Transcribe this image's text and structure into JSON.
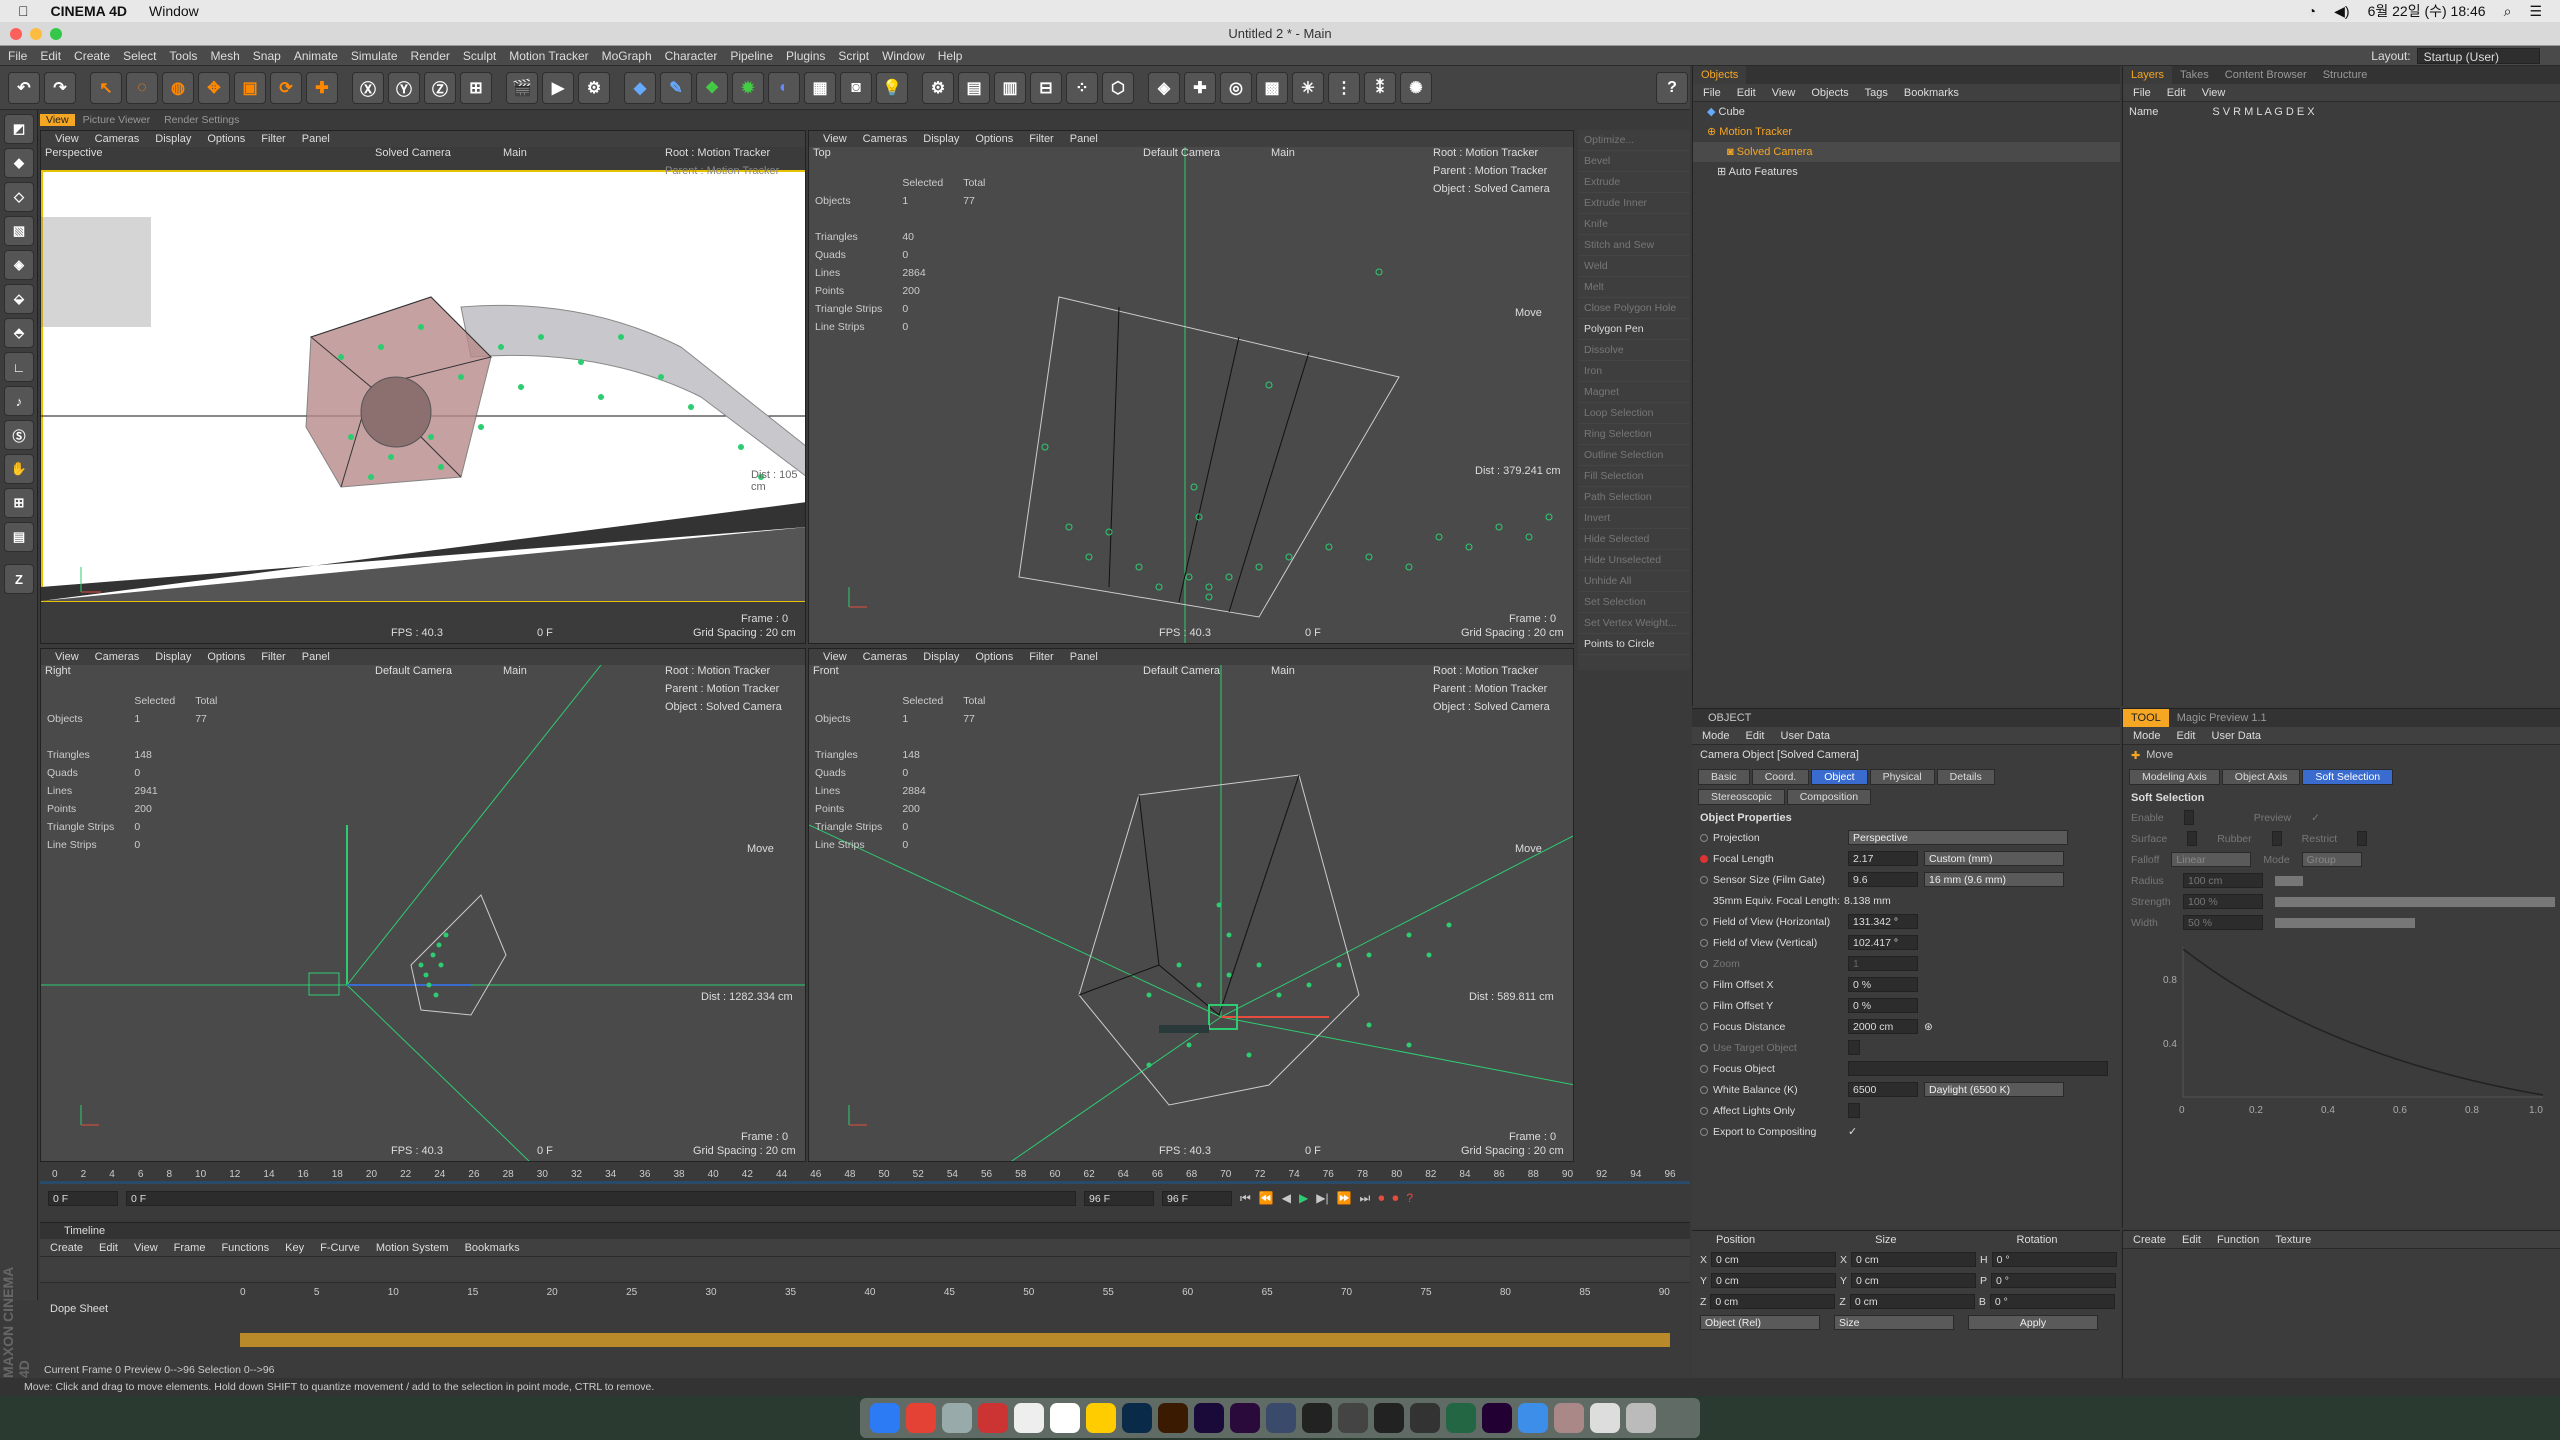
{
  "macbar": {
    "app": "CINEMA 4D",
    "menu": "Window",
    "clock": "6월 22일 (수) 18:46"
  },
  "window": {
    "title": "Untitled 2 * - Main"
  },
  "menu": [
    "File",
    "Edit",
    "Create",
    "Select",
    "Tools",
    "Mesh",
    "Snap",
    "Animate",
    "Simulate",
    "Render",
    "Sculpt",
    "Motion Tracker",
    "MoGraph",
    "Character",
    "Pipeline",
    "Plugins",
    "Script",
    "Window",
    "Help"
  ],
  "layout": {
    "label": "Layout:",
    "value": "Startup (User)"
  },
  "viewtabs": [
    "View",
    "Picture Viewer",
    "Render Settings"
  ],
  "vp_menu": [
    "View",
    "Cameras",
    "Display",
    "Options",
    "Filter",
    "Panel"
  ],
  "vp1": {
    "name": "Perspective",
    "camera": "Solved Camera",
    "main": "Main",
    "root": "Root : Motion Tracker",
    "parent": "Parent : Motion Tracker",
    "fps": "FPS : 40.3",
    "frame_f": "0 F",
    "frame": "Frame : 0",
    "grid": "Grid Spacing : 20 cm",
    "dist": "Dist : 105 cm"
  },
  "vp2": {
    "name": "Top",
    "camera": "Default Camera",
    "main": "Main",
    "root": "Root : Motion Tracker",
    "parent": "Parent : Motion Tracker",
    "object": "Object : Solved Camera",
    "move": "Move",
    "dist": "Dist : 379.241 cm",
    "fps": "FPS : 40.3",
    "frame_f": "0 F",
    "frame": "Frame : 0",
    "grid": "Grid Spacing : 20 cm",
    "stats": {
      "hdr_sel": "Selected",
      "hdr_tot": "Total",
      "objects": "Objects",
      "obj_sel": "1",
      "obj_tot": "77",
      "triangles": "Triangles",
      "tri": "40",
      "quads": "Quads",
      "qd": "0",
      "lines": "Lines",
      "ln": "2864",
      "points": "Points",
      "pt": "200",
      "tstrips": "Triangle Strips",
      "ts": "0",
      "lstrips": "Line Strips",
      "ls": "0"
    }
  },
  "vp3": {
    "name": "Right",
    "camera": "Default Camera",
    "main": "Main",
    "root": "Root : Motion Tracker",
    "parent": "Parent : Motion Tracker",
    "object": "Object : Solved Camera",
    "move": "Move",
    "dist": "Dist : 1282.334 cm",
    "fps": "FPS : 40.3",
    "frame_f": "0 F",
    "frame": "Frame : 0",
    "grid": "Grid Spacing : 20 cm",
    "stats": {
      "hdr_sel": "Selected",
      "hdr_tot": "Total",
      "objects": "Objects",
      "obj_sel": "1",
      "obj_tot": "77",
      "triangles": "Triangles",
      "tri": "148",
      "quads": "Quads",
      "qd": "0",
      "lines": "Lines",
      "ln": "2941",
      "points": "Points",
      "pt": "200",
      "tstrips": "Triangle Strips",
      "ts": "0",
      "lstrips": "Line Strips",
      "ls": "0"
    }
  },
  "vp4": {
    "name": "Front",
    "camera": "Default Camera",
    "main": "Main",
    "root": "Root : Motion Tracker",
    "parent": "Parent : Motion Tracker",
    "object": "Object : Solved Camera",
    "move": "Move",
    "dist": "Dist : 589.811 cm",
    "fps": "FPS : 40.3",
    "frame_f": "0 F",
    "frame": "Frame : 0",
    "grid": "Grid Spacing : 20 cm",
    "stats": {
      "hdr_sel": "Selected",
      "hdr_tot": "Total",
      "objects": "Objects",
      "obj_sel": "1",
      "obj_tot": "77",
      "triangles": "Triangles",
      "tri": "148",
      "quads": "Quads",
      "qd": "0",
      "lines": "Lines",
      "ln": "2884",
      "points": "Points",
      "pt": "200",
      "tstrips": "Triangle Strips",
      "ts": "0",
      "lstrips": "Line Strips",
      "ls": "0"
    }
  },
  "commands": [
    "Optimize...",
    "Bevel",
    "Extrude",
    "Extrude Inner",
    "Knife",
    "Stitch and Sew",
    "Weld",
    "Melt",
    "Close Polygon Hole",
    "Polygon Pen",
    "Dissolve",
    "Iron",
    "Magnet",
    "Loop Selection",
    "Ring Selection",
    "Outline Selection",
    "Fill Selection",
    "Path Selection",
    "Invert",
    "Hide Selected",
    "Hide Unselected",
    "Unhide All",
    "Set Selection",
    "Set Vertex Weight...",
    "Points to Circle"
  ],
  "objects": {
    "tab": "Objects",
    "menu": [
      "File",
      "Edit",
      "View",
      "Objects",
      "Tags",
      "Bookmarks"
    ],
    "items": [
      "Cube",
      "Motion Tracker",
      "Solved Camera",
      "Auto Features"
    ]
  },
  "layers": {
    "tabs": [
      "Layers",
      "Takes",
      "Content Browser",
      "Structure"
    ],
    "menu": [
      "File",
      "Edit",
      "View"
    ],
    "name": "Name",
    "cols": "S V R M L A G D E X"
  },
  "attrs": {
    "title": "OBJECT",
    "menu": [
      "Mode",
      "Edit",
      "User Data"
    ],
    "objname": "Camera Object [Solved Camera]",
    "tabs": [
      "Basic",
      "Coord.",
      "Object",
      "Physical",
      "Details"
    ],
    "tabs2": [
      "Stereoscopic",
      "Composition"
    ],
    "section": "Object Properties",
    "props": [
      {
        "k": "Projection",
        "v": "Perspective"
      },
      {
        "k": "Focal Length",
        "v": "2.17",
        "d": "Custom (mm)"
      },
      {
        "k": "Sensor Size (Film Gate)",
        "v": "9.6",
        "d": "16 mm (9.6 mm)"
      },
      {
        "k": "35mm Equiv. Focal Length:",
        "v": "8.138 mm"
      },
      {
        "k": "Field of View (Horizontal)",
        "v": "131.342 °"
      },
      {
        "k": "Field of View (Vertical)",
        "v": "102.417 °"
      },
      {
        "k": "Zoom",
        "v": "1"
      },
      {
        "k": "Film Offset X",
        "v": "0 %"
      },
      {
        "k": "Film Offset Y",
        "v": "0 %"
      },
      {
        "k": "Focus Distance",
        "v": "2000 cm"
      },
      {
        "k": "Use Target Object",
        "v": ""
      },
      {
        "k": "Focus Object",
        "v": ""
      },
      {
        "k": "White Balance (K)",
        "v": "6500",
        "d": "Daylight (6500 K)"
      },
      {
        "k": "Affect Lights Only",
        "v": ""
      },
      {
        "k": "Export to Compositing",
        "v": "✓"
      }
    ]
  },
  "tool": {
    "tabs": [
      "TOOL",
      "Magic Preview 1.1"
    ],
    "menu": [
      "Mode",
      "Edit",
      "User Data"
    ],
    "name": "Move",
    "subtabs": [
      "Modeling Axis",
      "Object Axis",
      "Soft Selection"
    ],
    "section": "Soft Selection",
    "enable": "Enable",
    "preview": "Preview",
    "surface": "Surface",
    "rubber": "Rubber",
    "restrict": "Restrict",
    "falloff": "Falloff",
    "falloff_v": "Linear",
    "mode": "Mode",
    "mode_v": "Group",
    "radius": "Radius",
    "radius_v": "100 cm",
    "strength": "Strength",
    "strength_v": "100 %",
    "width": "Width",
    "width_v": "50 %",
    "graph": {
      "y": [
        "0.8",
        "0.4"
      ],
      "x": [
        "0",
        "0.2",
        "0.4",
        "0.6",
        "0.8",
        "1.0"
      ]
    }
  },
  "timeline": {
    "ticks": [
      "0",
      "2",
      "4",
      "6",
      "8",
      "10",
      "12",
      "14",
      "16",
      "18",
      "20",
      "22",
      "24",
      "26",
      "28",
      "30",
      "32",
      "34",
      "36",
      "38",
      "40",
      "42",
      "44",
      "46",
      "48",
      "50",
      "52",
      "54",
      "56",
      "58",
      "60",
      "62",
      "64",
      "66",
      "68",
      "70",
      "72",
      "74",
      "76",
      "78",
      "80",
      "82",
      "84",
      "86",
      "88",
      "90",
      "92",
      "94",
      "96"
    ],
    "cur": "0 F",
    "start": "0 F",
    "end_a": "96 F",
    "end_b": "96 F"
  },
  "dope": {
    "title": "Timeline",
    "menu": [
      "Create",
      "Edit",
      "View",
      "Frame",
      "Functions",
      "Key",
      "F-Curve",
      "Motion System",
      "Bookmarks"
    ],
    "label": "Dope Sheet",
    "ticks": [
      "0",
      "5",
      "10",
      "15",
      "20",
      "25",
      "30",
      "35",
      "40",
      "45",
      "50",
      "55",
      "60",
      "65",
      "70",
      "75",
      "80",
      "85",
      "90"
    ],
    "status": "Current Frame  0   Preview  0-->96    Selection  0-->96"
  },
  "coords": {
    "headers": [
      "Position",
      "Size",
      "Rotation"
    ],
    "rows": [
      {
        "a": "X",
        "p": "0 cm",
        "b": "X",
        "s": "0 cm",
        "c": "H",
        "r": "0 °"
      },
      {
        "a": "Y",
        "p": "0 cm",
        "b": "Y",
        "s": "0 cm",
        "c": "P",
        "r": "0 °"
      },
      {
        "a": "Z",
        "p": "0 cm",
        "b": "Z",
        "s": "0 cm",
        "c": "B",
        "r": "0 °"
      }
    ],
    "mode1": "Object (Rel)",
    "mode2": "Size",
    "apply": "Apply"
  },
  "createpanel": {
    "menu": [
      "Create",
      "Edit",
      "Function",
      "Texture"
    ]
  },
  "brand": "MAXON CINEMA 4D",
  "status": "Move: Click and drag to move elements. Hold down SHIFT to quantize movement / add to the selection in point mode, CTRL to remove.",
  "colors": {
    "accent": "#f5a623",
    "select": "#3a6cd0",
    "axis_green": "#2ecc71",
    "axis_red": "#e74c3c"
  }
}
